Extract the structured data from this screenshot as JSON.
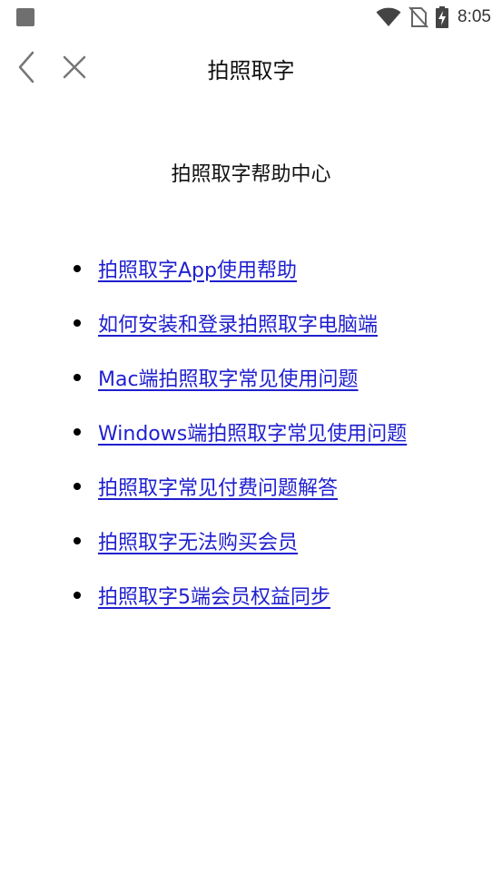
{
  "status_bar": {
    "time": "8:05",
    "icons": [
      "notification-square-icon",
      "wifi-icon",
      "no-sim-icon",
      "battery-charging-icon"
    ]
  },
  "nav": {
    "title": "拍照取字",
    "icons": [
      "chevron-left-icon",
      "close-icon"
    ]
  },
  "page": {
    "heading": "拍照取字帮助中心",
    "links": [
      "拍照取字App使用帮助",
      "如何安装和登录拍照取字电脑端",
      "Mac端拍照取字常见使用问题",
      "Windows端拍照取字常见使用问题",
      "拍照取字常见付费问题解答",
      "拍照取字无法购买会员",
      "拍照取字5端会员权益同步"
    ]
  },
  "colors": {
    "link": "#1f1fcf",
    "text": "#111111",
    "background": "#ffffff",
    "icon_gray": "#777777"
  }
}
